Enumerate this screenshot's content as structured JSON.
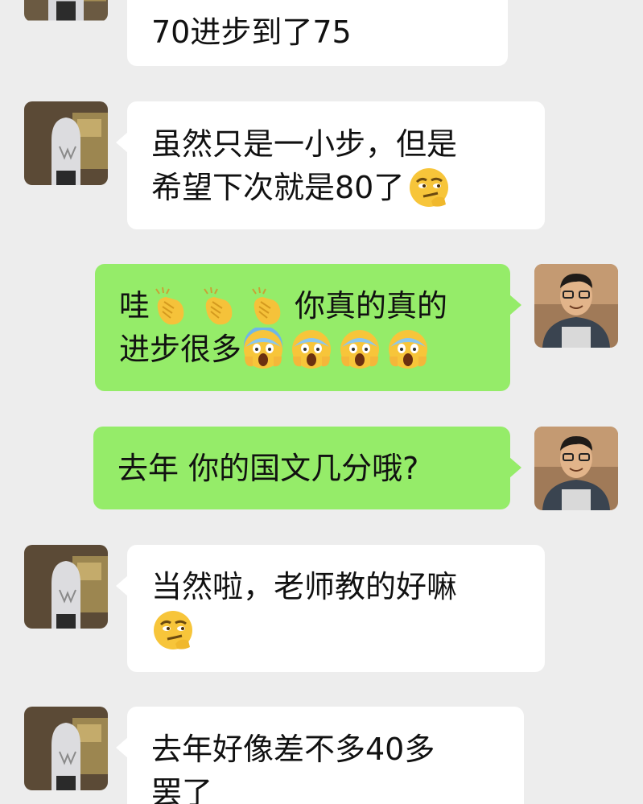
{
  "messages": [
    {
      "side": "in",
      "lines": [
        "70进步到了75"
      ]
    },
    {
      "side": "in",
      "lines": [
        "虽然只是一小步，但是",
        "希望下次就是80了"
      ],
      "emoji_after": "smirk-emoji"
    },
    {
      "side": "out",
      "line1_prefix": "哇",
      "line1_suffix": "你真的真的",
      "line2_text": "进步很多",
      "clap_emoji": "clapping-hands-emoji",
      "scream_emoji": "screaming-face-emoji"
    },
    {
      "side": "out",
      "lines": [
        "去年 你的国文几分哦?"
      ]
    },
    {
      "side": "in",
      "lines": [
        "当然啦，老师教的好嘛"
      ],
      "emoji_line": "smirk-emoji"
    },
    {
      "side": "in",
      "lines": [
        "去年好像差不多40多",
        "罢了"
      ]
    }
  ],
  "colors": {
    "background": "#ededed",
    "incoming_bubble": "#ffffff",
    "outgoing_bubble": "#95ec69"
  }
}
